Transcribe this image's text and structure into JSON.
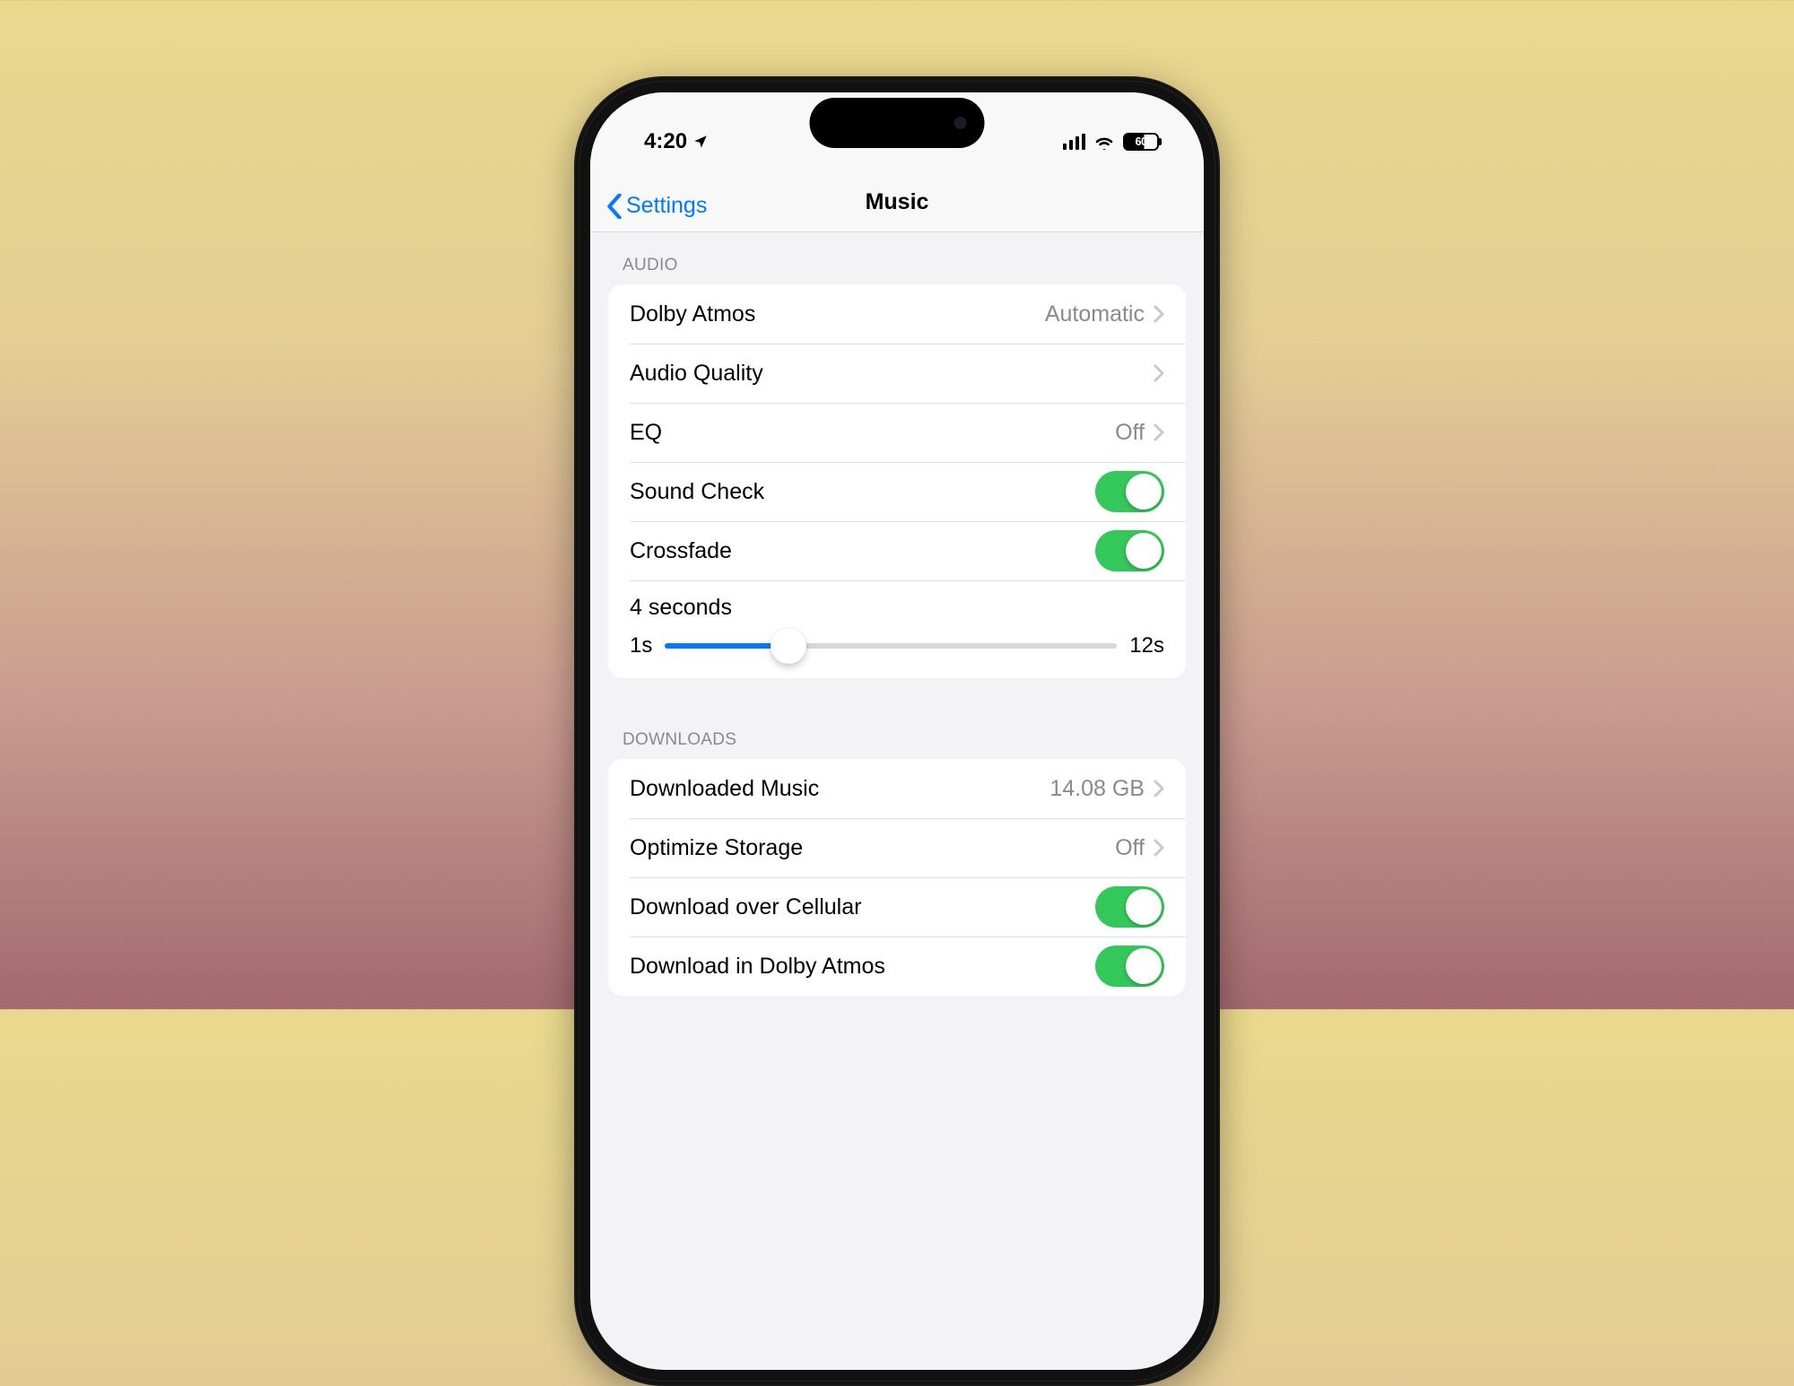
{
  "status": {
    "time": "4:20",
    "battery_percent": "60"
  },
  "nav": {
    "back_label": "Settings",
    "title": "Music"
  },
  "sections": {
    "audio": {
      "header": "AUDIO",
      "dolby_atmos": {
        "label": "Dolby Atmos",
        "value": "Automatic"
      },
      "audio_quality": {
        "label": "Audio Quality"
      },
      "eq": {
        "label": "EQ",
        "value": "Off"
      },
      "sound_check": {
        "label": "Sound Check",
        "on": true
      },
      "crossfade": {
        "label": "Crossfade",
        "on": true
      },
      "crossfade_slider": {
        "value_label": "4 seconds",
        "min_label": "1s",
        "max_label": "12s",
        "min": 1,
        "max": 12,
        "value": 4
      }
    },
    "downloads": {
      "header": "DOWNLOADS",
      "downloaded_music": {
        "label": "Downloaded Music",
        "value": "14.08 GB"
      },
      "optimize_storage": {
        "label": "Optimize Storage",
        "value": "Off"
      },
      "download_cellular": {
        "label": "Download over Cellular",
        "on": true
      },
      "download_dolby": {
        "label": "Download in Dolby Atmos",
        "on": true
      }
    }
  }
}
